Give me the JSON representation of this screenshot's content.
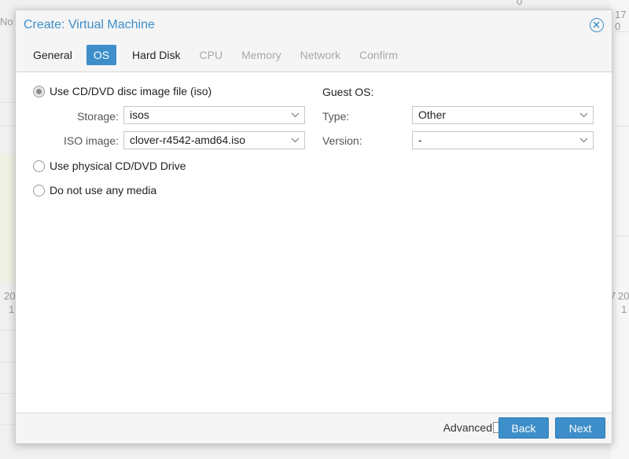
{
  "background": {
    "fragments": [
      "No",
      "0",
      "17",
      "0",
      "20",
      "1",
      "7",
      "20",
      "1"
    ]
  },
  "dialog": {
    "title": "Create: Virtual Machine",
    "tabs": [
      {
        "label": "General",
        "state": "normal"
      },
      {
        "label": "OS",
        "state": "active"
      },
      {
        "label": "Hard Disk",
        "state": "normal"
      },
      {
        "label": "CPU",
        "state": "disabled"
      },
      {
        "label": "Memory",
        "state": "disabled"
      },
      {
        "label": "Network",
        "state": "disabled"
      },
      {
        "label": "Confirm",
        "state": "disabled"
      }
    ],
    "media": {
      "option_iso": "Use CD/DVD disc image file (iso)",
      "storage_label": "Storage:",
      "storage_value": "isos",
      "iso_label": "ISO image:",
      "iso_value": "clover-r4542-amd64.iso",
      "option_physical": "Use physical CD/DVD Drive",
      "option_none": "Do not use any media",
      "selected": "iso"
    },
    "guest_os": {
      "title": "Guest OS:",
      "type_label": "Type:",
      "type_value": "Other",
      "version_label": "Version:",
      "version_value": "-"
    },
    "footer": {
      "advanced_label": "Advanced",
      "advanced_checked": false,
      "back_label": "Back",
      "next_label": "Next"
    }
  },
  "colors": {
    "accent": "#3d8ec9",
    "panel_bg": "#ffffff",
    "dialog_bg": "#f5f5f5"
  }
}
